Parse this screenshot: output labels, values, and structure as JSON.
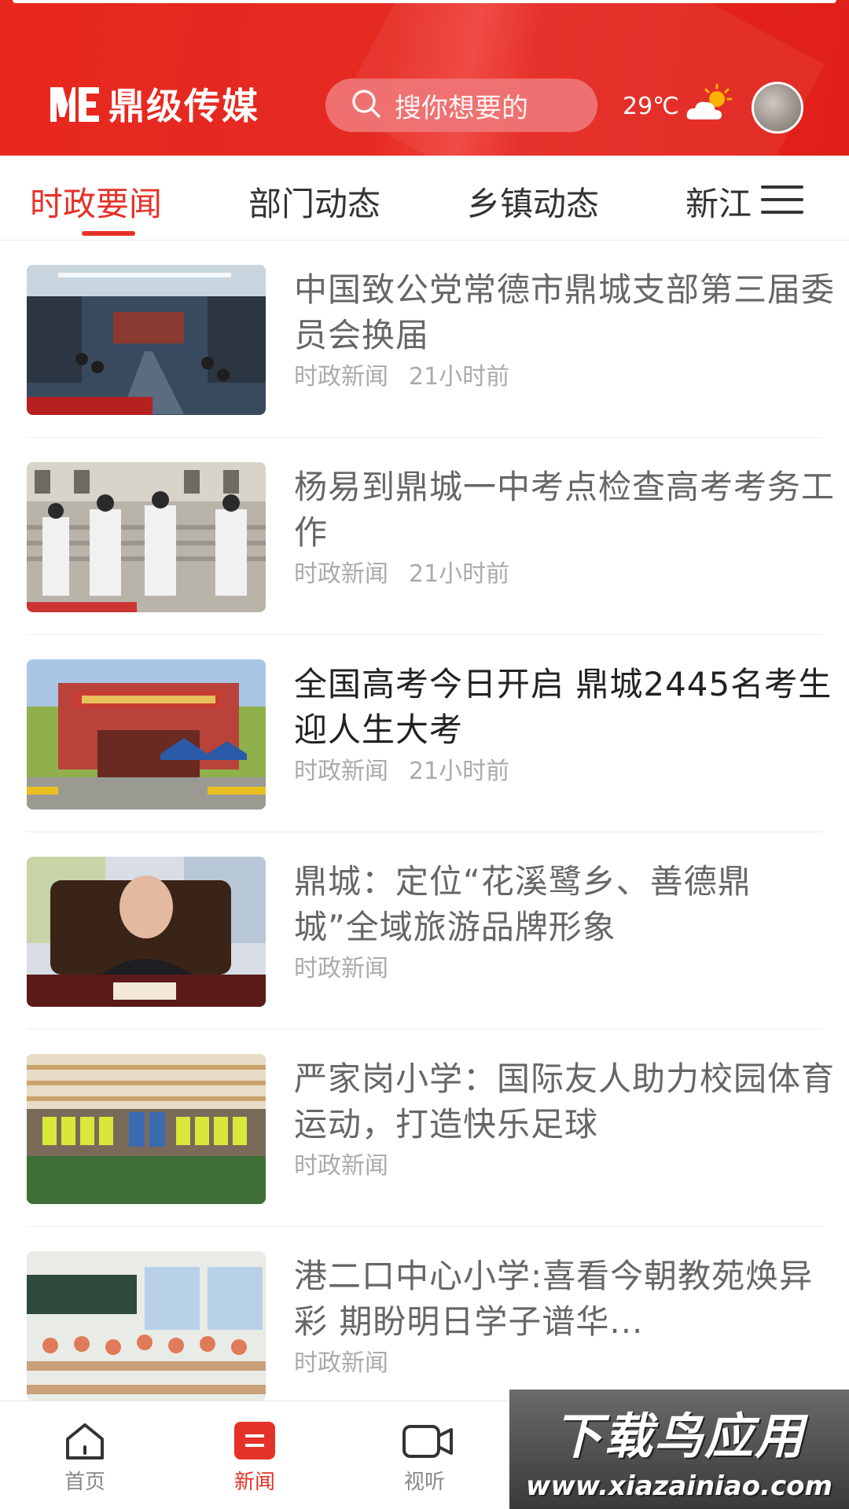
{
  "header": {
    "logo_text": "鼎级传媒",
    "search_placeholder": "搜你想要的",
    "temperature": "29℃",
    "weather_icon": "partly-sunny-icon",
    "colors": {
      "brand_red": "#e52a22",
      "accent_red": "#e53228"
    }
  },
  "tabs": [
    {
      "label": "时政要闻",
      "active": true
    },
    {
      "label": "部门动态",
      "active": false
    },
    {
      "label": "乡镇动态",
      "active": false
    },
    {
      "label": "新江",
      "active": false
    }
  ],
  "news": [
    {
      "title": "中国致公党常德市鼎城支部第三届委员会换届",
      "category": "时政新闻",
      "time": "21小时前"
    },
    {
      "title": "杨易到鼎城一中考点检查高考考务工作",
      "category": "时政新闻",
      "time": "21小时前"
    },
    {
      "title": "全国高考今日开启 鼎城2445名考生迎人生大考",
      "category": "时政新闻",
      "time": "21小时前"
    },
    {
      "title": "鼎城：定位“花溪鹭乡、善德鼎城”全域旅游品牌形象",
      "category": "时政新闻",
      "time": ""
    },
    {
      "title": "严家岗小学：国际友人助力校园体育运动，打造快乐足球",
      "category": "时政新闻",
      "time": ""
    },
    {
      "title": "港二口中心小学:喜看今朝教苑焕异彩 期盼明日学子谱华...",
      "category": "时政新闻",
      "time": ""
    }
  ],
  "bottom_nav": [
    {
      "label": "首页",
      "icon": "home-icon",
      "active": false
    },
    {
      "label": "新闻",
      "icon": "news-icon",
      "active": true
    },
    {
      "label": "视听",
      "icon": "video-camera-icon",
      "active": false
    }
  ],
  "watermark": {
    "title": "下载鸟应用",
    "url": "www.xiazainiao.com"
  }
}
